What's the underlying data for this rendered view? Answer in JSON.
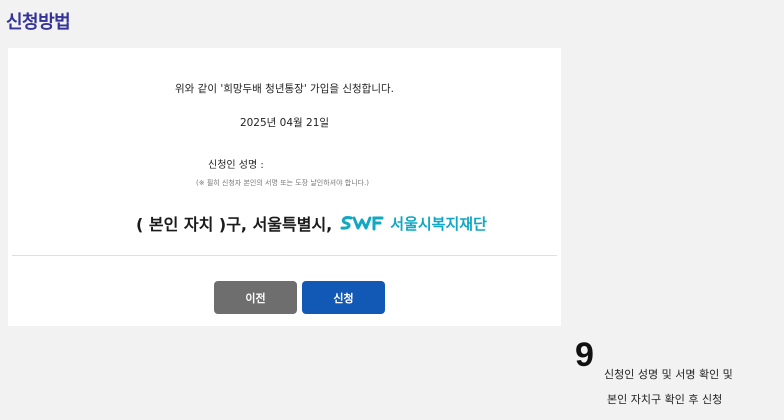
{
  "page": {
    "title": "신청방법"
  },
  "form": {
    "statement": "위와 같이 '희망두배 청년통장' 가입을 신청합니다.",
    "date": "2025년 04월 21일",
    "applicant_label": "신청인 성명 :",
    "note": "(※ 필히 신청자 본인의 서명 또는 도장 날인하셔야 합니다.)",
    "signature_line": "( 본인 자치 )구, 서울특별시,",
    "logo_text": "서울시복지재단",
    "logo_icon": "swf-logo-icon"
  },
  "buttons": {
    "prev_label": "이전",
    "submit_label": "신청"
  },
  "step": {
    "number": "9",
    "line1": "신청인 성명 및 서명 확인 및",
    "line2": "본인 자치구 확인 후 신청"
  },
  "colors": {
    "title": "#333399",
    "logo": "#12a7c3",
    "prev_button": "#6e6e6e",
    "submit_button": "#1258b5"
  }
}
